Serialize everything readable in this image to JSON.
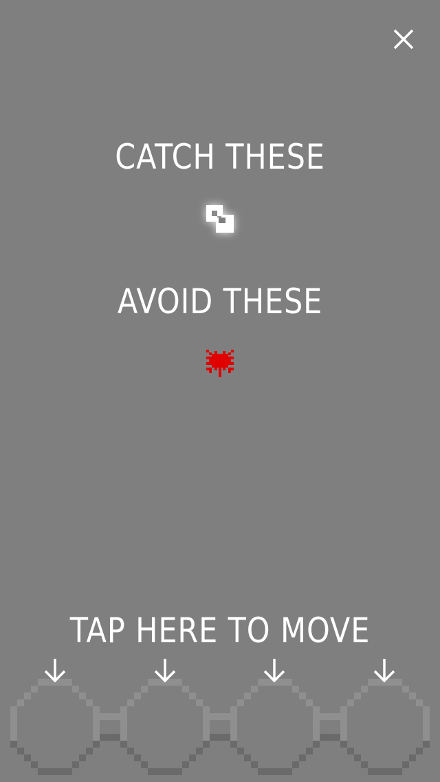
{
  "instructions": {
    "catch_label": "CATCH THESE",
    "avoid_label": "AVOID THESE",
    "tap_label": "TAP HERE TO MOVE"
  },
  "icons": {
    "close": "close-icon",
    "catch_item": "white-block-collectible-icon",
    "avoid_item": "red-bug-enemy-icon",
    "lane_arrow": "arrow-down-icon"
  },
  "colors": {
    "background": "#7f7f7f",
    "text": "#ffffff",
    "collectible": "#ffffff",
    "enemy": "#e00000",
    "lane_light": "#8f8f8f",
    "lane_dark": "#6a6a6a"
  },
  "lanes": [
    {
      "id": 1
    },
    {
      "id": 2
    },
    {
      "id": 3
    },
    {
      "id": 4
    }
  ]
}
